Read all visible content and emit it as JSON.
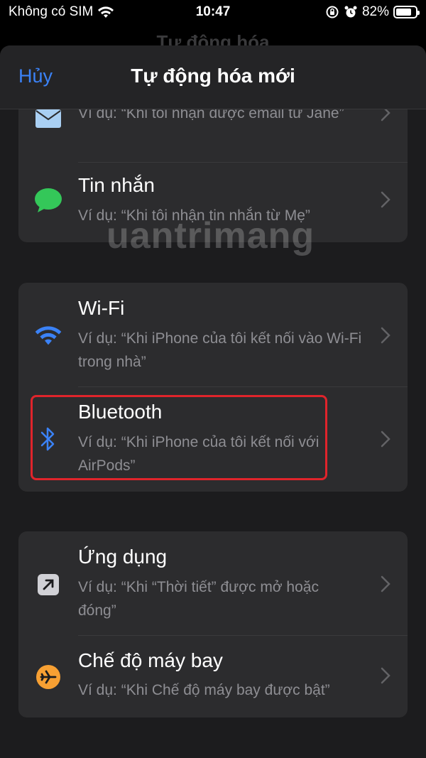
{
  "status_bar": {
    "carrier": "Không có SIM",
    "time": "10:47",
    "battery": "82%",
    "battery_level": 0.82
  },
  "background_title": "Tự động hóa",
  "nav": {
    "cancel_label": "Hủy",
    "title": "Tự động hóa mới"
  },
  "watermark": "uantrimang",
  "groups": [
    {
      "items": [
        {
          "title": "",
          "description": "Ví dụ: “Khi tôi nhận được email từ Jane”",
          "icon": "mail-icon"
        },
        {
          "title": "Tin nhắn",
          "description": "Ví dụ: “Khi tôi nhận tin nhắn từ Mẹ”",
          "icon": "message-icon"
        }
      ]
    },
    {
      "items": [
        {
          "title": "Wi-Fi",
          "description": "Ví dụ: “Khi iPhone của tôi kết nối vào Wi-Fi trong nhà”",
          "icon": "wifi-icon"
        },
        {
          "title": "Bluetooth",
          "description": "Ví dụ: “Khi iPhone của tôi kết nối với AirPods”",
          "icon": "bluetooth-icon"
        }
      ]
    },
    {
      "items": [
        {
          "title": "Ứng dụng",
          "description": "Ví dụ: “Khi “Thời tiết” được mở hoặc đóng”",
          "icon": "app-arrow-icon"
        },
        {
          "title": "Chế độ máy bay",
          "description": "Ví dụ: “Khi Chế độ máy bay được bật”",
          "icon": "airplane-icon"
        }
      ]
    }
  ],
  "colors": {
    "accent": "#3b82f6",
    "highlight": "#e0242b",
    "message_green": "#34c759",
    "airplane_orange": "#f7a033"
  }
}
